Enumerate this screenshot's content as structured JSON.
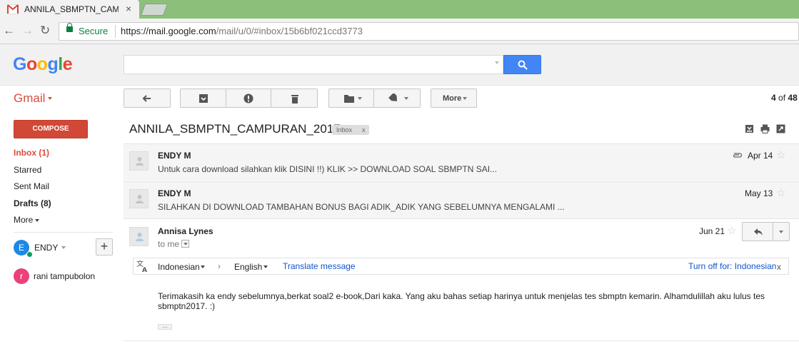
{
  "browser": {
    "tab_title": "ANNILA_SBMPTN_CAMP",
    "secure_label": "Secure",
    "url_host": "https://mail.google.com",
    "url_path": "/mail/u/0/#inbox/15b6bf021ccd3773"
  },
  "header": {
    "logo": [
      "G",
      "o",
      "o",
      "g",
      "l",
      "e"
    ],
    "search_value": ""
  },
  "actionbar": {
    "app_label": "Gmail",
    "more_label": "More",
    "count_current": "4",
    "count_of": "of",
    "count_total": "48"
  },
  "sidebar": {
    "compose_label": "COMPOSE",
    "items": [
      {
        "label": "Inbox (1)"
      },
      {
        "label": "Starred"
      },
      {
        "label": "Sent Mail"
      },
      {
        "label": "Drafts (8)"
      },
      {
        "label": "More"
      }
    ],
    "user": {
      "initial": "E",
      "name": "ENDY"
    },
    "contacts": [
      {
        "initial": "r",
        "name": "rani tampubolon"
      }
    ]
  },
  "thread": {
    "subject": "ANNILA_SBMPTN_CAMPURAN_2017",
    "label": "Inbox",
    "label_close": "x",
    "messages": [
      {
        "sender": "ENDY M",
        "snippet": "Untuk cara download silahkan klik DISINI !!) KLIK >> DOWNLOAD SOAL SBMPTN SAI...",
        "date": "Apr 14"
      },
      {
        "sender": "ENDY M",
        "snippet": "SILAHKAN DI DOWNLOAD TAMBAHAN BONUS BAGI ADIK_ADIK YANG SEBELUMNYA MENGALAMI ...",
        "date": "May 13"
      }
    ],
    "open": {
      "sender": "Annisa Lynes",
      "to": "to me",
      "date": "Jun 21",
      "body": "Terimakasih ka endy sebelumnya,berkat soal2 e-book,Dari kaka. Yang aku bahas setiap harinya untuk menjelas tes sbmptn kemarin. Alhamdulillah aku lulus tes sbmptn2017. :)"
    }
  },
  "translate": {
    "from": "Indonesian",
    "to": "English",
    "action": "Translate message",
    "turn_off": "Turn off for: Indonesian",
    "close": "x"
  },
  "colors": {
    "accent_red": "#dd4b39",
    "search_blue": "#4285f4",
    "secure_green": "#0b8043",
    "link_blue": "#1155cc"
  }
}
